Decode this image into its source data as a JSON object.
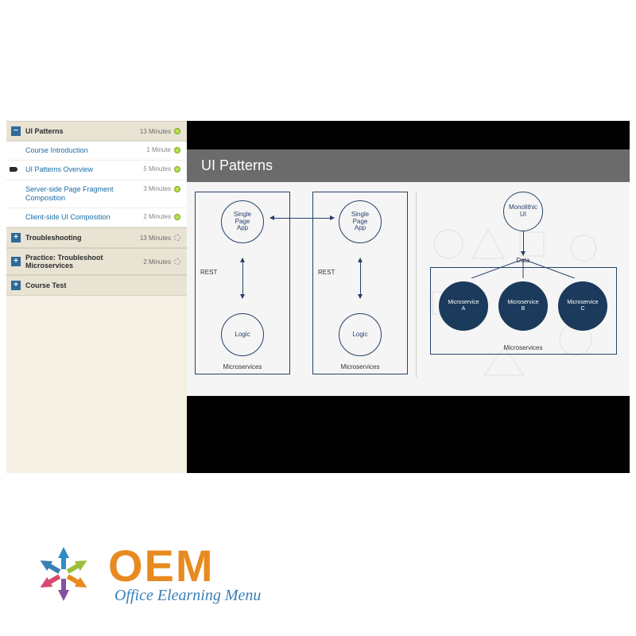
{
  "sidebar": {
    "sections": [
      {
        "title": "UI Patterns",
        "duration": "13 Minutes",
        "expanded": true,
        "status": "complete",
        "lessons": [
          {
            "title": "Course Introduction",
            "duration": "1 Minute",
            "status": "complete",
            "current": false
          },
          {
            "title": "UI Patterns Overview",
            "duration": "5 Minutes",
            "status": "complete",
            "current": true
          },
          {
            "title": "Server-side Page Fragment Composition",
            "duration": "3 Minutes",
            "status": "complete",
            "current": false
          },
          {
            "title": "Client-side UI Composition",
            "duration": "2 Minutes",
            "status": "complete",
            "current": false
          }
        ]
      },
      {
        "title": "Troubleshooting",
        "duration": "13 Minutes",
        "expanded": false,
        "status": "in-progress"
      },
      {
        "title": "Practice: Troubleshoot Microservices",
        "duration": "2 Minutes",
        "expanded": false,
        "status": "in-progress"
      },
      {
        "title": "Course Test",
        "duration": "",
        "expanded": false,
        "status": "none"
      }
    ]
  },
  "slide": {
    "title": "UI Patterns",
    "left": {
      "app": "Single\nPage\nApp",
      "logic": "Logic",
      "rest": "REST",
      "caption": "Microservices"
    },
    "right": {
      "mono": "Monolithic\nUI",
      "data": "Data",
      "services": [
        "Microservice\nA",
        "Microservice\nB",
        "Microservice\nC"
      ],
      "caption": "Microservices"
    }
  },
  "logo": {
    "title": "OEM",
    "subtitle": "Office Elearning Menu"
  },
  "glyph": {
    "plus": "+",
    "minus": "−"
  }
}
